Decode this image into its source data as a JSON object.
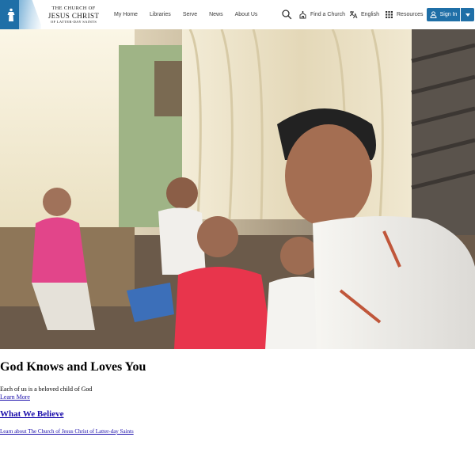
{
  "header": {
    "logo": {
      "line1": "THE CHURCH OF",
      "line2": "JESUS CHRIST",
      "line3": "OF LATTER-DAY SAINTS"
    },
    "nav": [
      "My Home",
      "Libraries",
      "Serve",
      "News",
      "About Us"
    ],
    "search_icon": "search-icon",
    "find_church_label": "Find a Church",
    "language_label": "English",
    "resources_label": "Resources",
    "sign_in_label": "Sign In",
    "brand_color": "#1f6fa7"
  },
  "hero": {
    "image_kind": "photo",
    "description_icon": "family-photo"
  },
  "main": {
    "title": "God Knows and Loves You",
    "subtitle": "Each of us is a beloved child of God",
    "learn_more": "Learn More",
    "section_title": "What We Believe",
    "section_link": "Learn about The Church of Jesus Christ of Latter-day Saints"
  }
}
